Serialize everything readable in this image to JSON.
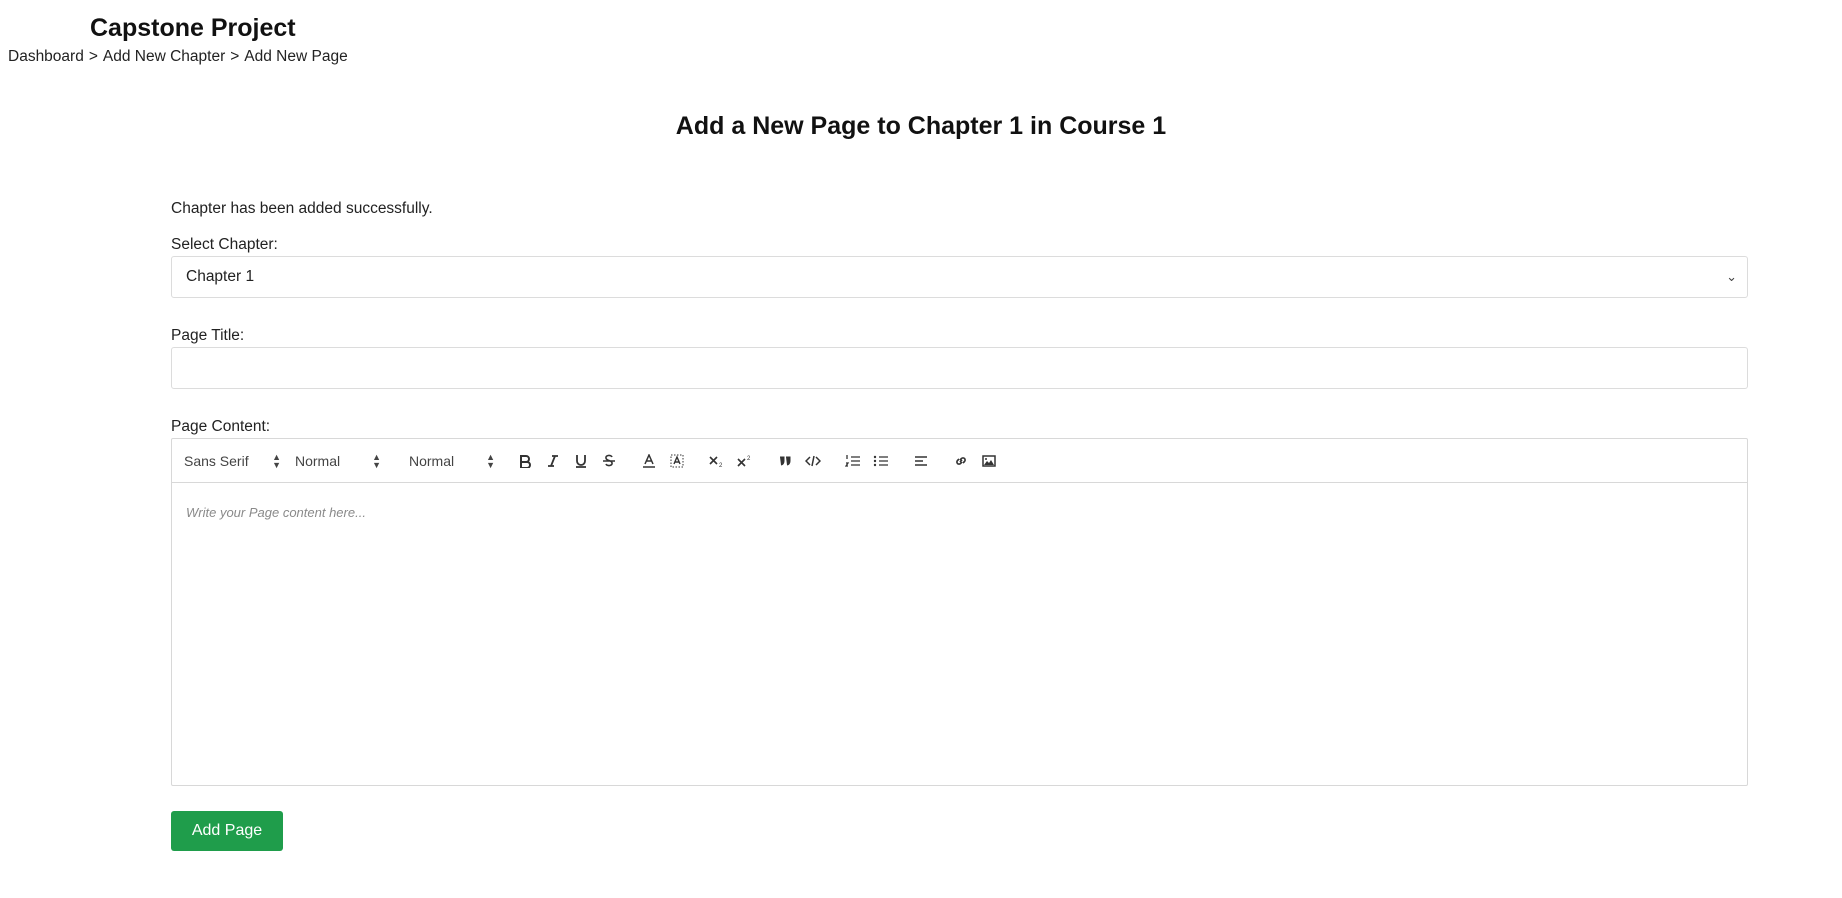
{
  "header": {
    "app_title": "Capstone Project",
    "breadcrumb": [
      "Dashboard",
      "Add New Chapter",
      "Add New Page"
    ],
    "separator": ">"
  },
  "main": {
    "heading": "Add a New Page to Chapter 1 in Course 1",
    "success_message": "Chapter has been added successfully.",
    "chapter_label": "Select Chapter:",
    "chapter_value": "Chapter 1",
    "title_label": "Page Title:",
    "title_value": "",
    "content_label": "Page Content:",
    "content_placeholder": "Write your Page content here...",
    "submit_label": "Add Page"
  },
  "toolbar": {
    "font": "Sans Serif",
    "size": "Normal",
    "header": "Normal",
    "buttons": [
      "bold-icon",
      "italic-icon",
      "underline-icon",
      "strikethrough-icon",
      "text-color-icon",
      "background-color-icon",
      "subscript-icon",
      "superscript-icon",
      "blockquote-icon",
      "code-block-icon",
      "ordered-list-icon",
      "bullet-list-icon",
      "align-left-icon",
      "link-icon",
      "image-icon"
    ]
  },
  "colors": {
    "accent": "#1f9d4b",
    "border": "#dcdcdc"
  }
}
